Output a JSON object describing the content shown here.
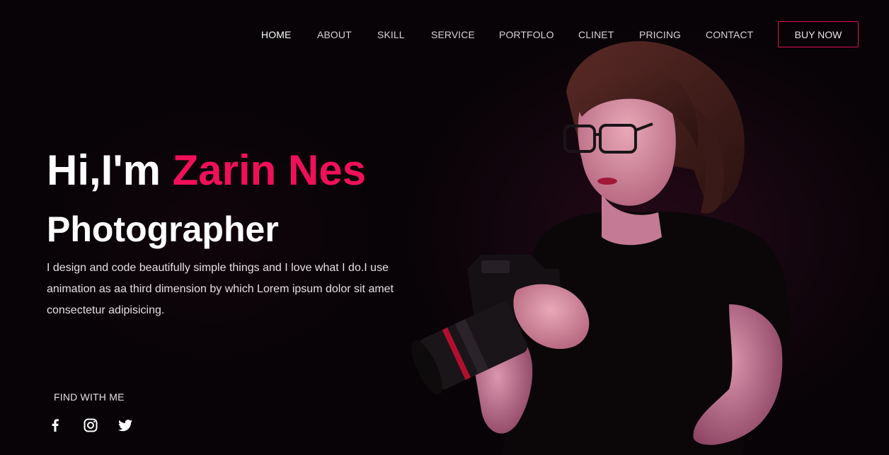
{
  "nav": {
    "items": [
      {
        "label": "HOME",
        "active": true
      },
      {
        "label": "ABOUT"
      },
      {
        "label": "SKILL"
      },
      {
        "label": "SERVICE"
      },
      {
        "label": "PORTFOLO"
      },
      {
        "label": "CLINET"
      },
      {
        "label": "PRICING"
      },
      {
        "label": "CONTACT"
      }
    ],
    "cta_label": "BUY NOW"
  },
  "hero": {
    "greeting": "Hi,I'm",
    "name": "Zarin Nes",
    "role": "Photographer",
    "description_lines": [
      "I design and code beautifully simple things and I love what I do.I use",
      "animation as aa third dimension by which Lorem ipsum dolor sit amet",
      "consectetur adipisicing."
    ]
  },
  "social": {
    "heading": "FIND WITH ME",
    "icons": [
      "facebook-icon",
      "instagram-icon",
      "twitter-icon"
    ]
  },
  "colors": {
    "accent": "#f0105a",
    "background": "#070306",
    "text": "#ffffff"
  }
}
